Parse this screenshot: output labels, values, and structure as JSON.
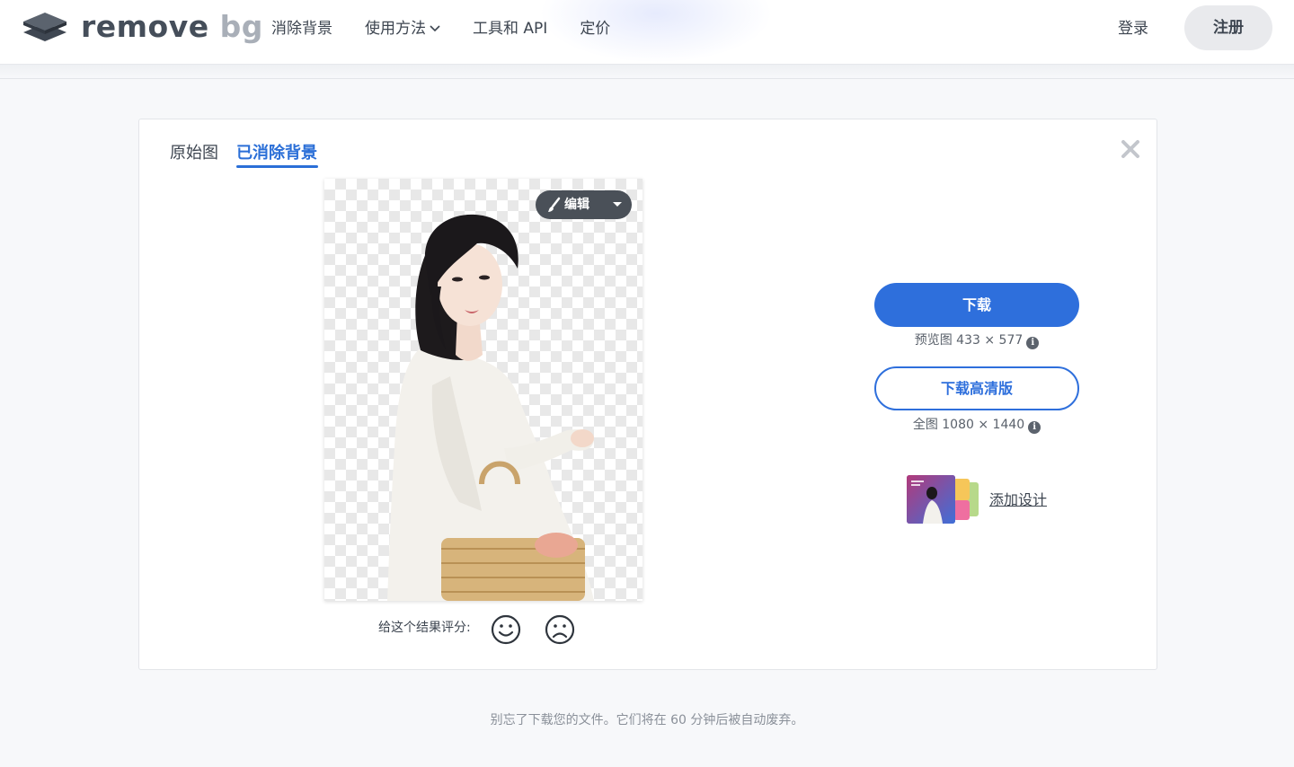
{
  "header": {
    "logo": {
      "word1": "remove",
      "word2": "bg"
    },
    "nav": [
      {
        "label": "消除背景"
      },
      {
        "label": "使用方法",
        "has_dropdown": true
      },
      {
        "label": "工具和 API"
      },
      {
        "label": "定价"
      }
    ],
    "login_label": "登录",
    "signup_label": "注册"
  },
  "card": {
    "tabs": {
      "original": "原始图",
      "removed": "已消除背景",
      "active": "removed"
    },
    "close_icon": "close-icon",
    "edit_button": {
      "label": "编辑",
      "icon": "brush-icon"
    },
    "rating": {
      "label": "给这个结果评分:",
      "icons": [
        "smile-icon",
        "frown-icon"
      ]
    },
    "download": {
      "label": "下载",
      "preview_text": "预览图 433 × 577",
      "hd_label": "下载高清版",
      "full_text": "全图 1080 × 1440"
    },
    "design": {
      "label": "添加设计"
    }
  },
  "footer": {
    "note": "别忘了下载您的文件。它们将在 60 分钟后被自动废弃。"
  },
  "colors": {
    "accent": "#2e6fdc",
    "background": "#f7f8fa",
    "edit_pill": "#4a5058"
  }
}
